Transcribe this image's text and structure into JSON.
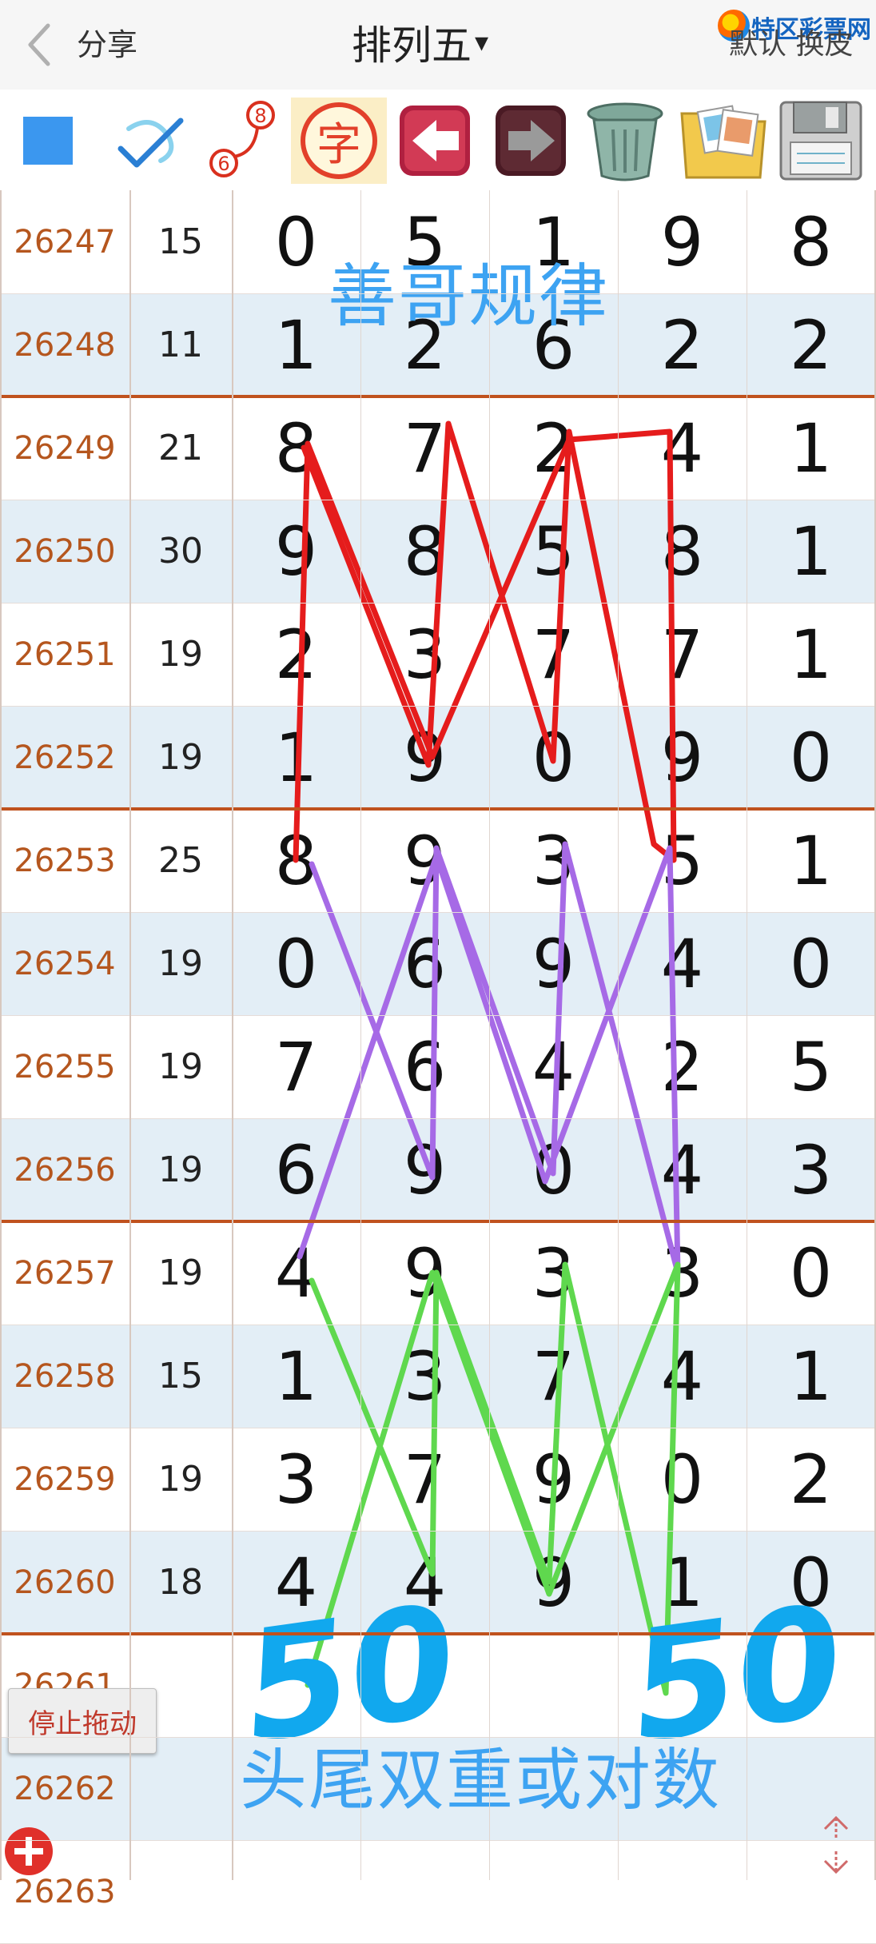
{
  "header": {
    "share_label": "分享",
    "title": "排列五",
    "title_caret": "▾",
    "logo_text": "特区彩票网",
    "skin_label": "默认 换皮"
  },
  "toolbar": {
    "icons": [
      "square-icon",
      "check-pen-icon",
      "number-link-icon",
      "char-icon",
      "back-arrow-icon",
      "forward-arrow-icon",
      "trash-icon",
      "photo-folder-icon",
      "save-icon"
    ],
    "number_link": {
      "a": "6",
      "b": "8"
    },
    "char_label": "字"
  },
  "table": {
    "rows": [
      {
        "issue": "26247",
        "sum": "15",
        "digits": [
          "0",
          "5",
          "1",
          "9",
          "8"
        ]
      },
      {
        "issue": "26248",
        "sum": "11",
        "digits": [
          "1",
          "2",
          "6",
          "2",
          "2"
        ]
      },
      {
        "issue": "26249",
        "sum": "21",
        "digits": [
          "8",
          "7",
          "2",
          "4",
          "1"
        ]
      },
      {
        "issue": "26250",
        "sum": "30",
        "digits": [
          "9",
          "8",
          "5",
          "8",
          "1"
        ]
      },
      {
        "issue": "26251",
        "sum": "19",
        "digits": [
          "2",
          "3",
          "7",
          "7",
          "1"
        ]
      },
      {
        "issue": "26252",
        "sum": "19",
        "digits": [
          "1",
          "9",
          "0",
          "9",
          "0"
        ]
      },
      {
        "issue": "26253",
        "sum": "25",
        "digits": [
          "8",
          "9",
          "3",
          "5",
          "1"
        ]
      },
      {
        "issue": "26254",
        "sum": "19",
        "digits": [
          "0",
          "6",
          "9",
          "4",
          "0"
        ]
      },
      {
        "issue": "26255",
        "sum": "19",
        "digits": [
          "7",
          "6",
          "4",
          "2",
          "5"
        ]
      },
      {
        "issue": "26256",
        "sum": "19",
        "digits": [
          "6",
          "9",
          "0",
          "4",
          "3"
        ]
      },
      {
        "issue": "26257",
        "sum": "19",
        "digits": [
          "4",
          "9",
          "3",
          "3",
          "0"
        ]
      },
      {
        "issue": "26258",
        "sum": "15",
        "digits": [
          "1",
          "3",
          "7",
          "4",
          "1"
        ]
      },
      {
        "issue": "26259",
        "sum": "19",
        "digits": [
          "3",
          "7",
          "9",
          "0",
          "2"
        ]
      },
      {
        "issue": "26260",
        "sum": "18",
        "digits": [
          "4",
          "4",
          "9",
          "1",
          "0"
        ]
      },
      {
        "issue": "26261",
        "sum": "",
        "digits": [
          "",
          "",
          "",
          "",
          ""
        ]
      },
      {
        "issue": "26262",
        "sum": "",
        "digits": [
          "",
          "",
          "",
          "",
          ""
        ]
      },
      {
        "issue": "26263",
        "sum": "",
        "digits": [
          "",
          "",
          "",
          "",
          ""
        ]
      }
    ]
  },
  "annotations": {
    "top_text": "善哥规律",
    "bottom_text": "头尾双重或对数",
    "big_left": "50",
    "big_right": "50"
  },
  "buttons": {
    "stop_drag": "停止拖动"
  },
  "colors": {
    "issue_text": "#b5561e",
    "separator": "#c0521e",
    "shaded_row": "#e3eef6",
    "red_line": "#e51c1c",
    "purple_line": "#a66ae6",
    "green_line": "#5fd84e",
    "annotation_blue": "#3da3f2",
    "big_number_blue": "#11a8ee"
  }
}
